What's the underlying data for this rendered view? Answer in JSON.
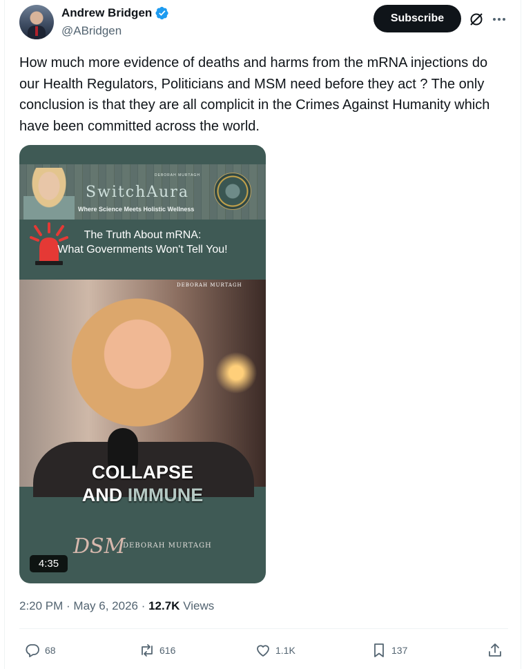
{
  "author": {
    "display_name": "Andrew Bridgen",
    "handle": "@ABridgen",
    "verified": true
  },
  "header": {
    "subscribe_label": "Subscribe",
    "grok_icon": "grok-icon",
    "more_icon": "more-icon"
  },
  "tweet": {
    "text": "How much more evidence of deaths and harms from the mRNA injections do our Health Regulators, Politicians and MSM need before they act ? The only conclusion is that they are all complicit in the Crimes Against Humanity which have been committed across the world."
  },
  "video": {
    "brand": "SwitchAura",
    "brand_small": "DEBORAH MURTAGH",
    "tagline": "Where Science Meets Holistic Wellness",
    "headline_line1": "The Truth About mRNA:",
    "headline_line2": "What Governments Won't Tell You!",
    "photo_signature": "DEBORAH MURTAGH",
    "caption_line1": "COLLAPSE",
    "caption_line2_a": "AND ",
    "caption_line2_b": "IMMUNE",
    "logo_mark": "DSM",
    "logo_text": "DEBORAH MURTAGH",
    "duration": "4:35"
  },
  "meta": {
    "time": "2:20 PM",
    "separator": " · ",
    "date": "May 6, 2026",
    "views_count": "12.7K",
    "views_label": " Views"
  },
  "actions": {
    "replies": "68",
    "reposts": "616",
    "likes": "1.1K",
    "bookmarks": "137"
  },
  "colors": {
    "verified": "#1d9bf0",
    "text_primary": "#0f1419",
    "text_secondary": "#536471",
    "video_panel": "#3f5a55"
  }
}
